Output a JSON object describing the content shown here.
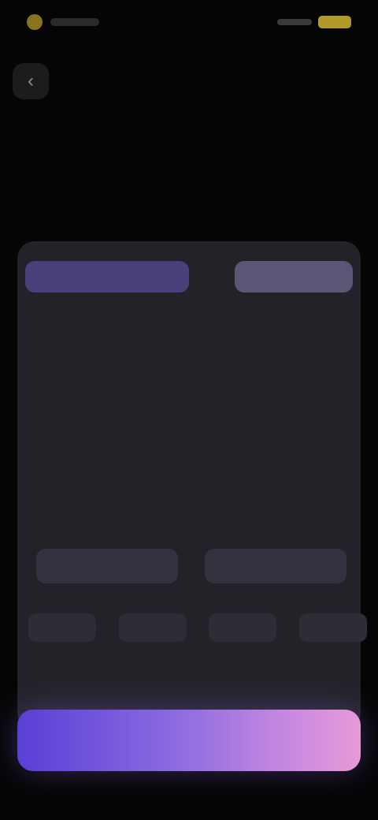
{
  "status_bar": {},
  "header": {
    "back_glyph": "‹",
    "title": ""
  },
  "hero": {
    "title": "",
    "subtitle": ""
  },
  "card": {
    "tab_left": "",
    "tab_right": "",
    "body": "",
    "meta_left": "",
    "meta_right": "",
    "options": [
      "",
      ""
    ],
    "tags": [
      "",
      "",
      "",
      ""
    ],
    "link": ""
  },
  "cta": {
    "label": ""
  },
  "colors": {
    "background": "#050505",
    "card": "#232228",
    "accent": "#8a6ae0",
    "cta_start": "#5a3fd6",
    "cta_end": "#e79ad6",
    "highlight": "#b0643a"
  },
  "icons": {
    "back": "chevron-left-icon"
  }
}
